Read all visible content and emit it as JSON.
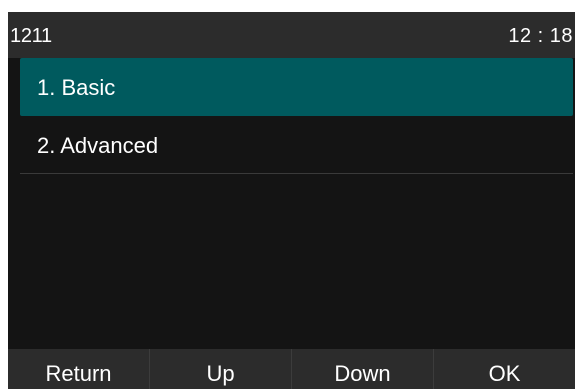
{
  "status_bar": {
    "account": "1211",
    "time": "12 : 18"
  },
  "menu": {
    "items": [
      {
        "label": "1.  Basic",
        "selected": true
      },
      {
        "label": "2.  Advanced",
        "selected": false
      }
    ]
  },
  "softkeys": {
    "return_label": "Return",
    "up_label": "Up",
    "down_label": "Down",
    "ok_label": "OK"
  },
  "colors": {
    "screen_background": "#141414",
    "bar_background": "#2c2c2c",
    "selection_highlight": "#005a5e",
    "text": "#ffffff"
  }
}
